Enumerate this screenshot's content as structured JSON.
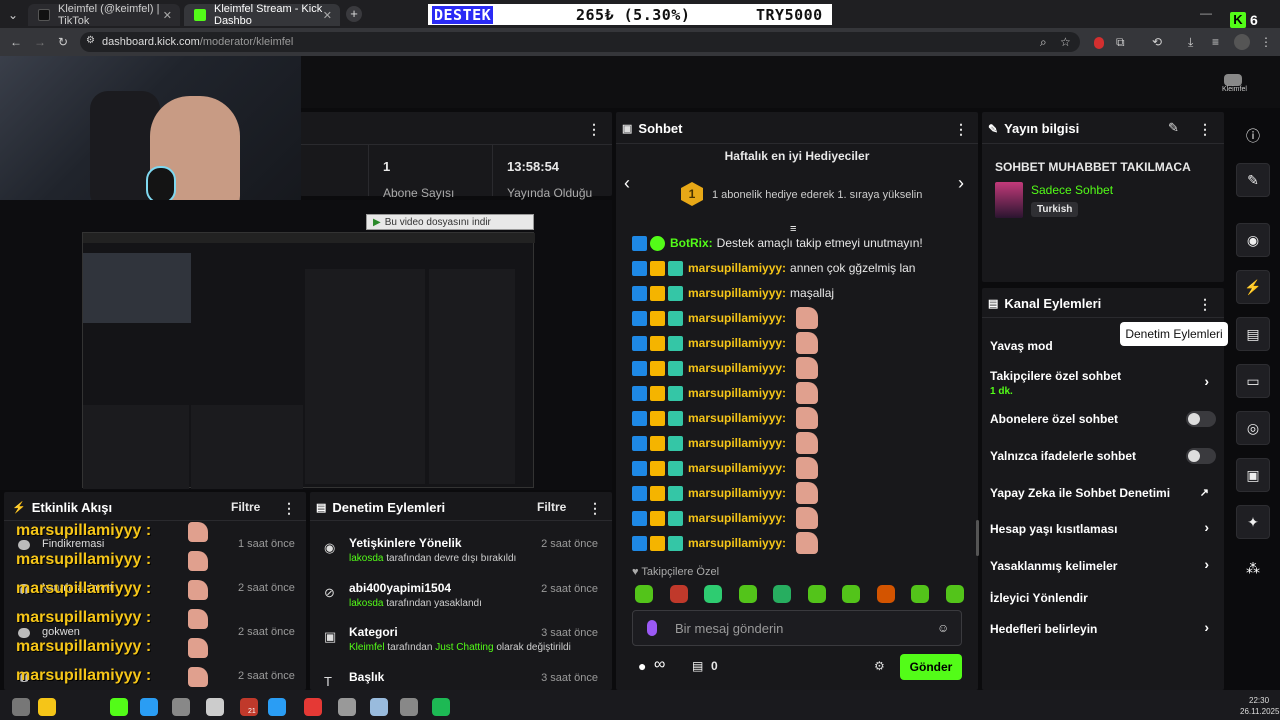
{
  "browser": {
    "tabs": [
      {
        "title": "Kleimfel (@keimfel) | TikTok"
      },
      {
        "title": "Kleimfel Stream - Kick Dashbo"
      }
    ],
    "new_tab": "+",
    "close": "✕",
    "url_domain": "dashboard.kick.com",
    "url_path": "/moderator/kleimfel",
    "corner_badge": "6"
  },
  "ticker": {
    "left": "DESTEK",
    "mid": "265₺ (5.30%)",
    "right": "TRY5000"
  },
  "header": {
    "profile_label": "Kleimfel"
  },
  "stats": {
    "subs_value": "1",
    "subs_label": "Abone Sayısı",
    "time_value": "13:58:54",
    "time_label": "Yayında Olduğu"
  },
  "download_bar": "Bu video dosyasını indir",
  "chat": {
    "title": "Sohbet",
    "gifters_title": "Haftalık en iyi Hediyeciler",
    "gifters_rank": "1",
    "gifters_text": "1 abonelik hediye ederek 1. sıraya yükselin",
    "bot_name": "BotRix:",
    "bot_msg": "Destek amaçlı takip etmeyi unutmayın!",
    "messages": [
      {
        "user": "marsupillamiyyy:",
        "text": "annen çok gğzelmiş lan"
      },
      {
        "user": "marsupillamiyyy:",
        "text": "maşallaj"
      },
      {
        "user": "marsupillamiyyy:",
        "text": ""
      },
      {
        "user": "marsupillamiyyy:",
        "text": ""
      },
      {
        "user": "marsupillamiyyy:",
        "text": ""
      },
      {
        "user": "marsupillamiyyy:",
        "text": ""
      },
      {
        "user": "marsupillamiyyy:",
        "text": ""
      },
      {
        "user": "marsupillamiyyy:",
        "text": ""
      },
      {
        "user": "marsupillamiyyy:",
        "text": ""
      },
      {
        "user": "marsupillamiyyy:",
        "text": ""
      },
      {
        "user": "marsupillamiyyy:",
        "text": ""
      },
      {
        "user": "marsupillamiyyy:",
        "text": ""
      }
    ],
    "followers_only": "Takipçilere Özel",
    "input_placeholder": "Bir mesaj gönderin",
    "infinity": "∞",
    "gift_count": "0",
    "send_label": "Gönder"
  },
  "stream_info": {
    "title": "Yayın bilgisi",
    "stream_title": "SOHBET MUHABBET TAKILMACA",
    "category": "Sadece Sohbet",
    "language": "Turkish"
  },
  "channel_actions": {
    "title": "Kanal Eylemleri",
    "tooltip": "Denetim Eylemleri",
    "items": [
      {
        "label": "Yavaş mod",
        "sub": ""
      },
      {
        "label": "Takipçilere özel sohbet",
        "sub": "1 dk."
      },
      {
        "label": "Abonelere özel sohbet",
        "sub": ""
      },
      {
        "label": "Yalnızca ifadelerle sohbet",
        "sub": ""
      },
      {
        "label": "Yapay Zeka ile Sohbet Denetimi",
        "sub": ""
      },
      {
        "label": "Hesap yaşı kısıtlaması",
        "sub": ""
      },
      {
        "label": "Yasaklanmış kelimeler",
        "sub": ""
      },
      {
        "label": "İzleyici Yönlendir",
        "sub": ""
      },
      {
        "label": "Hedefleri belirleyin",
        "sub": ""
      }
    ]
  },
  "activity": {
    "title": "Etkinlik Akışı",
    "filter": "Filtre",
    "overlay_name": "marsupillamiyyy :",
    "items": [
      {
        "name": "Findikremasi",
        "time": "1 saat önce"
      },
      {
        "name": "kanalı takip etti",
        "time": "2 saat önce"
      },
      {
        "name": "gokwen",
        "time": "2 saat önce"
      },
      {
        "name": "",
        "time": "2 saat önce"
      }
    ]
  },
  "moderation": {
    "title": "Denetim Eylemleri",
    "filter": "Filtre",
    "items": [
      {
        "title": "Yetişkinlere Yönelik",
        "actor": "lakosda",
        "desc": "tarafından devre dışı bırakıldı",
        "time": "2 saat önce"
      },
      {
        "title": "abi400yapimi1504",
        "actor": "lakosda",
        "desc": "tarafından yasaklandı",
        "time": "2 saat önce"
      },
      {
        "title": "Kategori",
        "actor": "Kleimfel",
        "desc": "tarafından",
        "extra": "Just Chatting",
        "desc2": "olarak değiştirildi",
        "time": "3 saat önce"
      },
      {
        "title": "Başlık",
        "actor": "",
        "desc": "",
        "time": "3 saat önce"
      }
    ]
  },
  "taskbar": {
    "time": "22:30",
    "date": "26.11.2025",
    "badge": "21"
  },
  "colors": {
    "accent": "#53fc18",
    "username": "#f5c518",
    "panel": "#18181b"
  }
}
